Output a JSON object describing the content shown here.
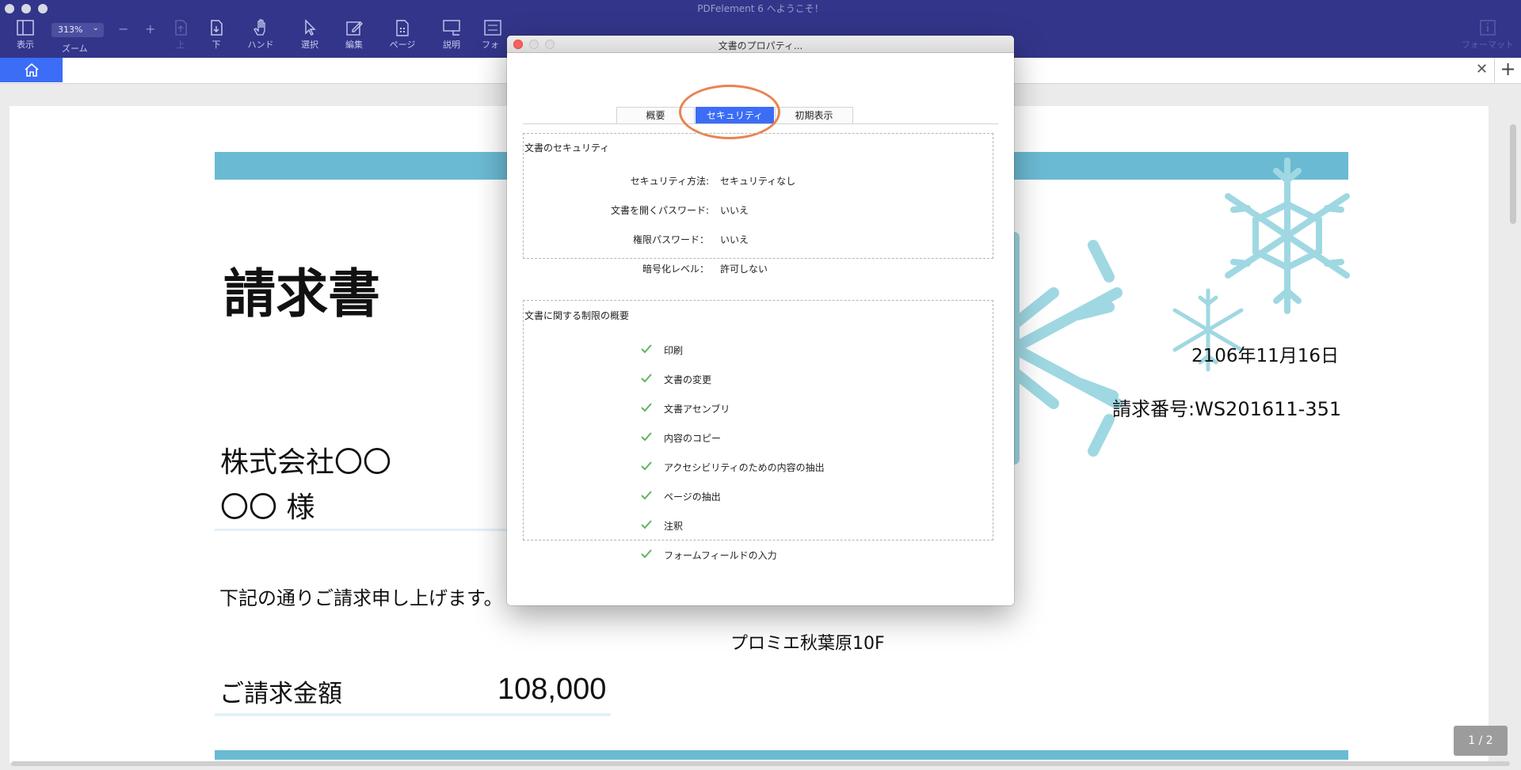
{
  "app": {
    "window_title": "PDFelement 6 へようこそ！"
  },
  "toolbar": {
    "zoom_value": "313%",
    "items": {
      "view": "表示",
      "zoom": "ズーム",
      "up": "上",
      "down": "下",
      "hand": "ハンド",
      "select": "選択",
      "edit": "編集",
      "page": "ページ",
      "comment": "説明",
      "form": "フォ",
      "format": "フォーマット"
    }
  },
  "dialog": {
    "title": "文書のプロパティ...",
    "tabs": [
      "概要",
      "セキュリティ",
      "初期表示"
    ],
    "active_tab": "セキュリティ",
    "security_section_title": "文書のセキュリティ",
    "security_rows": [
      {
        "label": "セキュリティ方法:",
        "value": "セキュリティなし"
      },
      {
        "label": "文書を開くパスワード:",
        "value": "いいえ"
      },
      {
        "label": "権限パスワード：",
        "value": "いいえ"
      },
      {
        "label": "暗号化レベル：",
        "value": "許可しない"
      }
    ],
    "restrictions_section_title": "文書に関する制限の概要",
    "permissions": [
      "印刷",
      "文書の変更",
      "文書アセンブリ",
      "内容のコピー",
      "アクセシビリティのための内容の抽出",
      "ページの抽出",
      "注釈",
      "フォームフィールドの入力"
    ]
  },
  "document": {
    "title": "請求書",
    "company": "株式会社〇〇",
    "recipient": "〇〇 様",
    "intro": "下記の通りご請求申し上げます。",
    "address": "プロミエ秋葉原10F",
    "amount_label": "ご請求金額",
    "amount_value": "108,000",
    "date": "2106年11月16日",
    "invoice_number": "請求番号:WS201611-351"
  },
  "page_indicator": "1 / 2",
  "colors": {
    "titlebar": "#33358a",
    "accent": "#3b6df6",
    "band": "#6bbad3",
    "highlight": "#e9834f",
    "check": "#5cb85c",
    "snow": "#9fd8e2"
  }
}
